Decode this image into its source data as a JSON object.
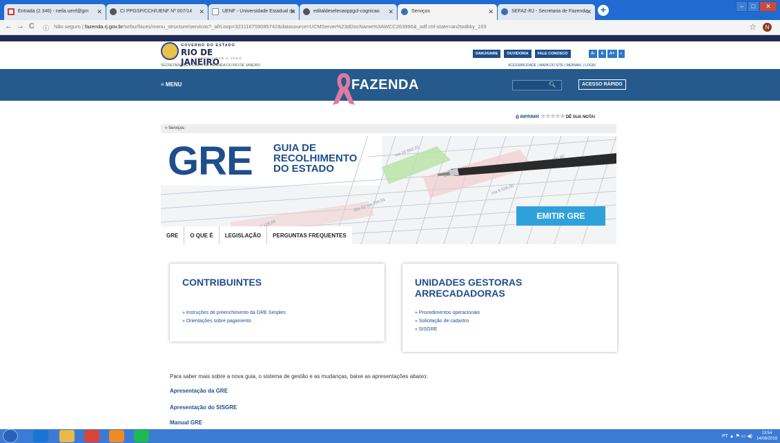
{
  "browser": {
    "tabs": [
      {
        "title": "Entrada (2.346) - neila.uenf@gm",
        "icon": "gmail-icon"
      },
      {
        "title": "CI PPGSP/CCH/UENF Nº 007/14",
        "icon": "page-icon"
      },
      {
        "title": "UENF - Universidade Estadual do",
        "icon": "document-icon"
      },
      {
        "title": "editaldeselecaoppgcl-cognicao",
        "icon": "page-icon"
      },
      {
        "title": "Serviços",
        "icon": "globe-icon"
      },
      {
        "title": "SEFAZ-RJ - Secretaria de Fazenda",
        "icon": "globe-icon"
      }
    ],
    "security": "Não seguro",
    "url_domain": "fazenda.rj.gov.br",
    "url_path": "/sefaz/faces/menu_structure/servicos?_afrLoop=323116759085742&datasource=UCMServer%23dDocName%3AWCC263996&_adf.ctrl-state=an2todkky_163",
    "profile_initial": "N"
  },
  "header": {
    "gov_top": "GOVERNO DO ESTADO",
    "gov_name": "RIO DE JANEIRO",
    "gov_sub": "VAMOS VIRAR O JOGO",
    "secretaria": "SECRETARIA DE ESTADO DE FAZENDA DO RIO DE JANEIRO",
    "top_links": [
      "DARJ/GNRE",
      "OUVIDORIA",
      "FALE CONOSCO"
    ],
    "font_buttons": [
      "A-",
      "A",
      "A+",
      "◐"
    ],
    "util_links": "ACESSIBILIDADE | MAPA DO SITE | WEBMAIL | LOGIN",
    "menu": "≡ MENU",
    "brand": "FAZENDA",
    "acesso": "ACESSO RÁPIDO"
  },
  "toolbar": {
    "print": "IMPRIMIR",
    "rating_label": "DÊ SUA NOTA!",
    "rating_stars": 0
  },
  "breadcrumb": "» Serviços",
  "banner": {
    "gre": "GRE",
    "guia": [
      "GUIA DE",
      "RECOLHIMENTO",
      "DO ESTADO"
    ],
    "emitir": "EMITIR GRE",
    "tabs": [
      "GRE",
      "O QUE É",
      "LEGISLAÇÃO",
      "PERGUNTAS FREQUENTES"
    ]
  },
  "cards": {
    "contribuintes": {
      "title": "CONTRIBUINTES",
      "links": [
        "» Instruções de preenchimento da GRE Simples",
        "» Orientações sobre pagamento"
      ]
    },
    "unidades": {
      "title_l1": "UNIDADES GESTORAS",
      "title_l2": "ARRECADADORAS",
      "links": [
        "» Procedimentos operacionais",
        "» Solicitação de cadastro",
        "» SISGRE"
      ]
    }
  },
  "intro": "Para saber mais sobre a nova guia, o sistema de gestão e as mudanças, baixe as apresentações abaixo:",
  "downloads": [
    "Apresentação da GRE",
    "Apresentação do SISGRE",
    "Manual GRE"
  ],
  "taskbar": {
    "lang": "PT",
    "time": "13:54",
    "date": "14/08/2019"
  },
  "colors": {
    "brand_blue": "#265a8c",
    "navy": "#1e2b56",
    "link_blue": "#1e4e8c",
    "emitir": "#2ea1db",
    "ribbon": "#e07aa0"
  }
}
